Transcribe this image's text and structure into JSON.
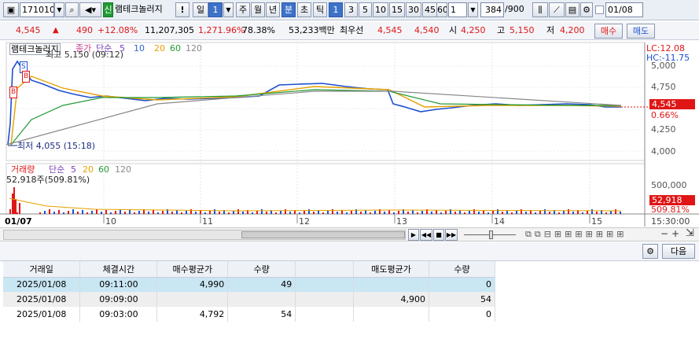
{
  "toolbar": {
    "code": "171010",
    "credit_badge": "신",
    "stock_name": "램테크놀러지",
    "excl": "!",
    "period_day": "일",
    "day_count": "1",
    "periods": [
      "주",
      "월",
      "년",
      "분",
      "초",
      "틱"
    ],
    "selected_period": "분",
    "minute_count": "1",
    "minute_intervals": [
      "3",
      "5",
      "10",
      "15",
      "30",
      "45",
      "60"
    ],
    "interval_input": "1",
    "bar_count": "384",
    "bar_total": "/900",
    "date": "01/08"
  },
  "infobar": {
    "price": "4,545",
    "change": "490",
    "change_pct": "+12.08%",
    "volume": "11,207,305",
    "volume_ratio": "1,271.96%",
    "turnover_ratio": "78.38%",
    "amount": "53,233백만",
    "best_quote_label": "최우선",
    "best_ask": "4,545",
    "best_bid": "4,540",
    "open_label": "시",
    "open": "4,250",
    "high_label": "고",
    "high": "5,150",
    "low_label": "저",
    "low": "4,200",
    "buy_button": "매수",
    "sell_button": "매도"
  },
  "price_chart": {
    "legend_name": "램테크놀러지",
    "legend_close": "종가",
    "legend_ma": "단순",
    "ma_periods": [
      "5",
      "10",
      "20",
      "60",
      "120"
    ],
    "lc": "LC:12.08",
    "hc": "HC:-11.75",
    "high_marker": "최고 5,150 (09:12)",
    "low_marker": "최저 4,055 (15:18)",
    "marker_s": "S",
    "marker_b": "B",
    "y_ticks": [
      "5,000",
      "4,750",
      "4,500",
      "4,250",
      "4,000"
    ],
    "current_price_tag": "4,545",
    "current_pct_tag": "0.66%"
  },
  "volume_chart": {
    "legend_name": "거래량",
    "legend_ma": "단순",
    "ma_periods": [
      "5",
      "20",
      "60",
      "120"
    ],
    "max_label": "52,918주(509.81%)",
    "y_tick": "500,000",
    "current_volume_tag": "52,918",
    "current_pct_tag": "509.81%"
  },
  "x_axis": {
    "labels": [
      "01/07",
      "10",
      "11",
      "12",
      "13",
      "14",
      "15"
    ],
    "end_time": "15:30:00"
  },
  "panel": {
    "next_button": "다음"
  },
  "trade_table": {
    "headers": [
      "거래일",
      "체결시간",
      "매수평균가",
      "수량",
      "",
      "매도평균가",
      "수량"
    ],
    "rows": [
      [
        "2025/01/08",
        "09:11:00",
        "4,990",
        "49",
        "",
        "",
        "0"
      ],
      [
        "2025/01/08",
        "09:09:00",
        "",
        "",
        "",
        "4,900",
        "54"
      ],
      [
        "2025/01/08",
        "09:03:00",
        "4,792",
        "54",
        "",
        "",
        "0"
      ]
    ]
  },
  "colors": {
    "up": "#e01616",
    "down": "#1c4fd0",
    "selected": "#3d72c8",
    "ma5": "#7a3fb8",
    "ma10": "#2f63c9",
    "ma20": "#e6a000",
    "ma60": "#1f9a32",
    "ma120": "#888888"
  }
}
